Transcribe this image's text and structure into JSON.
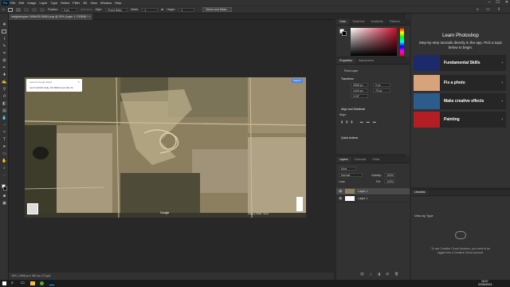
{
  "menu": {
    "logo": "Ps",
    "items": [
      "File",
      "Edit",
      "Image",
      "Layer",
      "Type",
      "Select",
      "Filter",
      "3D",
      "View",
      "Window",
      "Help"
    ],
    "window_controls": [
      "–",
      "☐",
      "✕"
    ]
  },
  "options_bar": {
    "feather_label": "Feather:",
    "feather_value": "0 px",
    "anti_alias": "Anti-alias",
    "style_label": "Style:",
    "style_value": "Fixed Ratio",
    "width_label": "Width:",
    "width_value": "1",
    "height_label": "Height:",
    "height_value": "1",
    "select_mask_button": "Select and Mask..."
  },
  "document": {
    "tab_title": "Insightstopper 1656425.SMN2.png @ 15% (Layer 1, RGB/8) *",
    "status": "15% | 1866 px x 962 px (72 ppi)"
  },
  "map_overlay": {
    "search_placeholder": "Search Google Maps",
    "search_suggestion": "Larch Hill Rd Holly, MI 48442 and 11th St",
    "search_button": "Search",
    "brand": "Google",
    "footer": "Imagery ©2020 · Terms"
  },
  "color_panel": {
    "tabs": [
      "Color",
      "Swatches",
      "Gradients",
      "Patterns"
    ],
    "fg_color": "#ffffff",
    "bg_color": "#000000",
    "hue_color": "#c8102e"
  },
  "properties_panel": {
    "tabs": [
      "Properties",
      "Adjustments"
    ],
    "layer_type": "Pixel Layer",
    "transform_heading": "Transform",
    "w_value": "2838 px",
    "h_value": "1444 px",
    "x_value": "0 px",
    "y_value": "75 px",
    "angle_value": "0.00°",
    "align_heading": "Align and Distribute",
    "align_label": "Align:",
    "quick_actions": "Quick Actions"
  },
  "layers_panel": {
    "tabs": [
      "Layers",
      "Channels",
      "Paths"
    ],
    "kind_label": "Kind",
    "blend_mode": "Normal",
    "opacity_label": "Opacity:",
    "opacity_value": "100%",
    "lock_label": "Lock:",
    "fill_label": "Fill:",
    "fill_value": "100%",
    "layers": [
      {
        "name": "Layer 1",
        "selected": true
      },
      {
        "name": "Layer 1",
        "selected": false
      }
    ]
  },
  "learn_panel": {
    "title": "Learn Photoshop",
    "subtitle": "Step-by-step tutorials directly in the app. Pick a topic below to begin.",
    "cards": [
      {
        "label": "Fundamental Skills",
        "color": "#1c2a6b"
      },
      {
        "label": "Fix a photo",
        "color": "#d8a37a"
      },
      {
        "label": "Make creative effects",
        "color": "#2c5c8c"
      },
      {
        "label": "Painting",
        "color": "#b21e24"
      }
    ]
  },
  "libraries_panel": {
    "title": "Libraries",
    "view_by": "View by Type",
    "message": "To use Creative Cloud Libraries, you need to be logged into a Creative Cloud account."
  },
  "taskbar": {
    "time": "15:07",
    "date": "22/05/2021"
  }
}
